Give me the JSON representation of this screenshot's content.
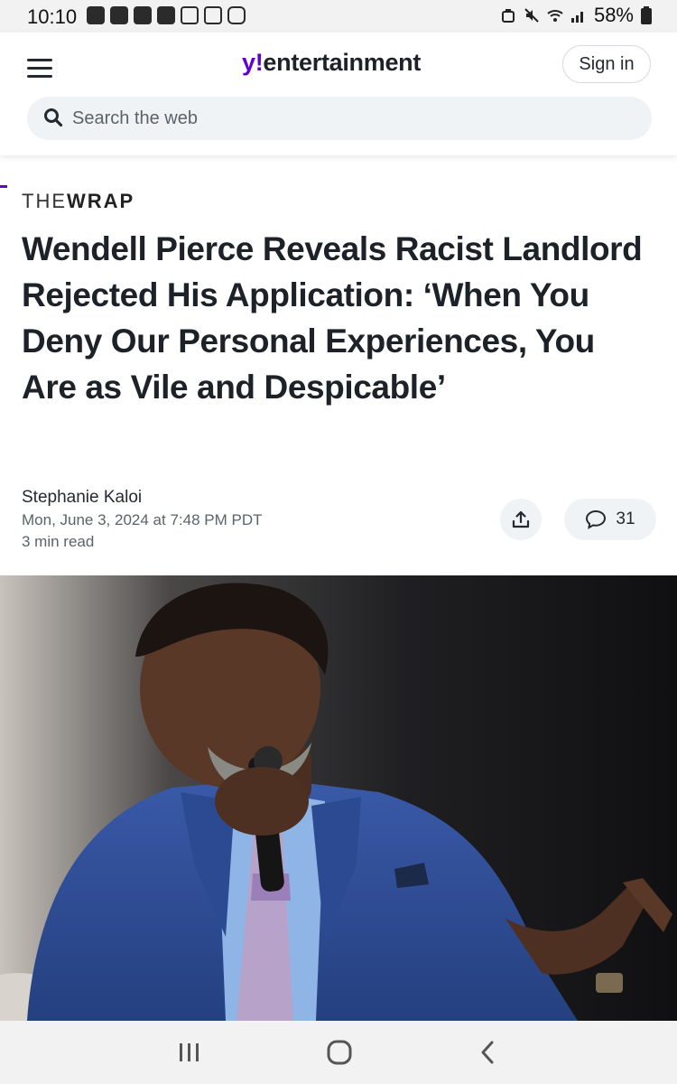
{
  "status_bar": {
    "time": "10:10",
    "battery": "58%",
    "notification_icons": [
      "n-icon",
      "n-icon",
      "n-icon",
      "n-icon",
      "video-icon",
      "image-icon",
      "instagram-icon"
    ],
    "system_icons": [
      "alarm-icon",
      "mute-icon",
      "wifi-icon",
      "signal-icon",
      "battery-icon"
    ]
  },
  "header": {
    "brand_prefix": "y!",
    "brand_name": "entertainment",
    "signin_label": "Sign in",
    "search_placeholder": "Search the web",
    "accent_color": "#6001d2"
  },
  "article": {
    "source_the": "THE",
    "source_wrap": "WRAP",
    "headline": "Wendell Pierce Reveals Racist Landlord Rejected His Application: ‘When You Deny Our Personal Experiences, You Are as Vile and Despicable’",
    "author": "Stephanie Kaloi",
    "date": "Mon, June 3, 2024 at 7:48 PM PDT",
    "read_time": "3 min read",
    "comment_count": "31"
  },
  "nav_bar": {
    "buttons": [
      "recents-icon",
      "home-icon",
      "back-icon"
    ]
  }
}
